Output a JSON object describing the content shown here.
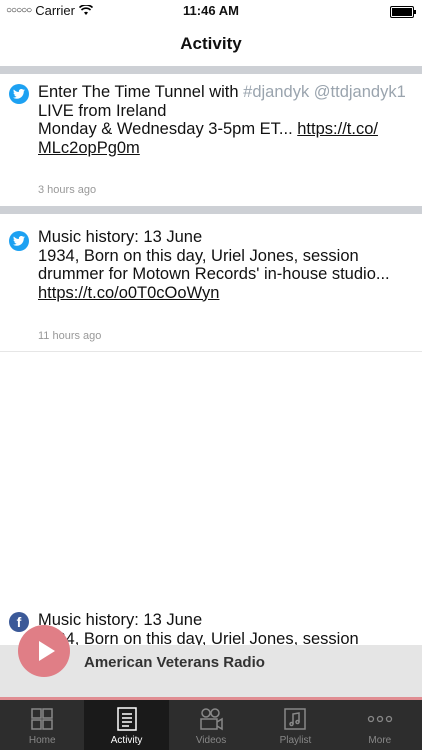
{
  "status": {
    "carrier": "Carrier",
    "time": "11:46 AM"
  },
  "nav": {
    "title": "Activity"
  },
  "feed": [
    {
      "source": "twitter",
      "line1_text": "Enter The Time Tunnel with ",
      "line1_tags": "#djandyk @ttdjandyk1",
      "line2": "LIVE from Ireland",
      "line3_text": "Monday & Wednesday 3-5pm ET... ",
      "link": "https://t.co/MLc2opPg0m",
      "link_a": "https://t.co/",
      "link_b": "MLc2opPg0m",
      "ago": "3 hours ago"
    },
    {
      "source": "twitter",
      "line1": "Music history: 13 June",
      "line2": "1934, Born on this day, Uriel Jones, session drummer for Motown Records' in-house studio...",
      "link": "https://t.co/o0T0cOoWyn",
      "ago": "11 hours ago"
    },
    {
      "source": "facebook",
      "line1": "Music history: 13 June",
      "line2": "1934, Born on this day, Uriel Jones, session"
    }
  ],
  "player": {
    "station": "American Veterans Radio"
  },
  "tabs": [
    {
      "label": "Home",
      "icon": "home-icon"
    },
    {
      "label": "Activity",
      "icon": "activity-icon"
    },
    {
      "label": "Videos",
      "icon": "videos-icon"
    },
    {
      "label": "Playlist",
      "icon": "playlist-icon"
    },
    {
      "label": "More",
      "icon": "more-icon"
    }
  ]
}
